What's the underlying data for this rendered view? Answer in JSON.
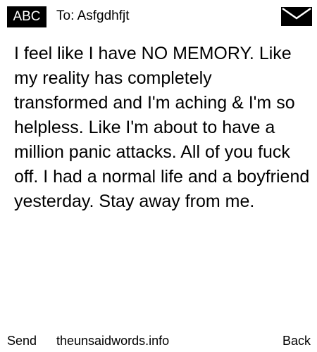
{
  "header": {
    "input_mode": "ABC",
    "to_label": "To: Asfgdhfjt",
    "icon": "envelope-icon"
  },
  "message": {
    "text": "I feel like I have NO MEMORY. Like my reality has completely transformed and I'm aching & I'm so helpless. Like I'm about to have a million panic attacks. All of you fuck off. I had a normal life and a boyfriend yesterday. Stay away from me."
  },
  "footer": {
    "send_label": "Send",
    "site_label": "theunsaidwords.info",
    "back_label": "Back"
  },
  "colors": {
    "background": "#ffffff",
    "foreground": "#000000"
  }
}
